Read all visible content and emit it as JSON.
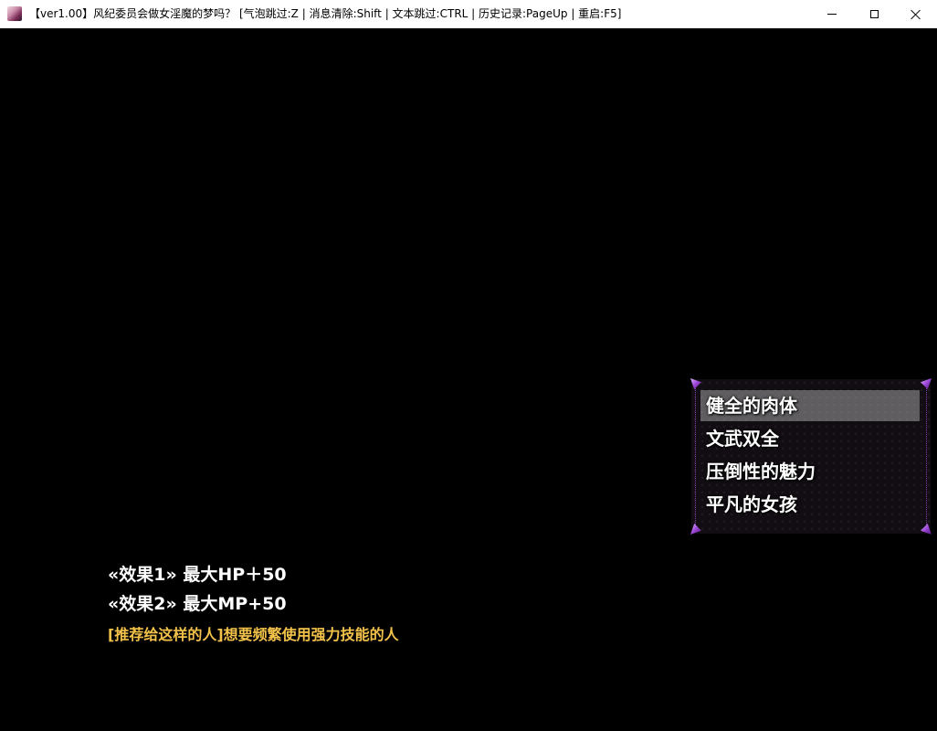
{
  "window": {
    "title": "【ver1.00】风纪委员会做女淫魔的梦吗？  [气泡跳过:Z | 消息清除:Shift | 文本跳过:CTRL | 历史记录:PageUp | 重启:F5]",
    "icon": "app-icon",
    "controls": [
      "minimize-icon",
      "maximize-icon",
      "close-icon"
    ]
  },
  "choices": {
    "items": [
      {
        "label": "健全的肉体",
        "selected": true
      },
      {
        "label": "文武双全",
        "selected": false
      },
      {
        "label": "压倒性的魅力",
        "selected": false
      },
      {
        "label": "平凡的女孩",
        "selected": false
      }
    ],
    "accent_color": "#9b46d6"
  },
  "description": {
    "effect_1": "«效果1» 最大HP＋50",
    "effect_2": "«效果2» 最大MP+50",
    "recommend": "[推荐给这样的人]想要频繁使用强力技能的人",
    "recommend_color": "#f2c24a"
  }
}
